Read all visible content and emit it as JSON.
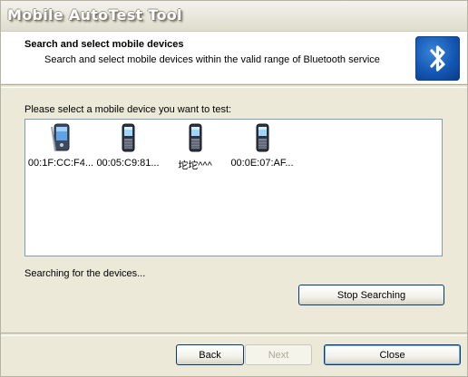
{
  "window": {
    "title": "Mobile AutoTest Tool"
  },
  "header": {
    "title": "Search and select mobile devices",
    "subtitle": "Search and select mobile devices within the valid range of Bluetooth service",
    "logo_icon": "bluetooth-icon"
  },
  "main": {
    "prompt": "Please select a mobile device you want to test:",
    "devices": [
      {
        "label": "00:1F:CC:F4...",
        "icon": "pda-icon"
      },
      {
        "label": "00:05:C9:81...",
        "icon": "phone-icon"
      },
      {
        "label": "坨坨^^^",
        "icon": "phone-icon"
      },
      {
        "label": "00:0E:07:AF...",
        "icon": "phone-icon"
      }
    ],
    "status": "Searching for the devices...",
    "stop_label": "Stop Searching"
  },
  "footer": {
    "back_label": "Back",
    "next_label": "Next",
    "close_label": "Close"
  },
  "colors": {
    "dialog_bg": "#ece9d8",
    "bluetooth_blue": "#1456b3",
    "button_border": "#003c74"
  }
}
